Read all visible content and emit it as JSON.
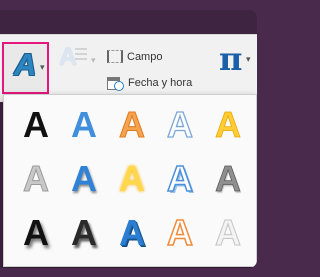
{
  "ribbon": {
    "wordart_button": {
      "icon": "wordart-a-icon",
      "glyph": "A",
      "color": "#2e86c1"
    },
    "ghost_button": {
      "glyph": "A"
    },
    "field_label": "Campo",
    "date_time_label": "Fecha y hora",
    "equation_glyph": "π"
  },
  "gallery": {
    "rows": [
      [
        {
          "glyph": "A",
          "style": "black-fill"
        },
        {
          "glyph": "A",
          "style": "blue-fill"
        },
        {
          "glyph": "A",
          "style": "orange-gradient-outline"
        },
        {
          "glyph": "A",
          "style": "blue-outline"
        },
        {
          "glyph": "A",
          "style": "gold-fill"
        }
      ],
      [
        {
          "glyph": "A",
          "style": "gray-outline"
        },
        {
          "glyph": "A",
          "style": "blue-shadow"
        },
        {
          "glyph": "A",
          "style": "yellow-glow"
        },
        {
          "glyph": "A",
          "style": "blue-outline-3d"
        },
        {
          "glyph": "A",
          "style": "gray-bevel"
        }
      ],
      [
        {
          "glyph": "A",
          "style": "black-shadow"
        },
        {
          "glyph": "A",
          "style": "dark-shadow"
        },
        {
          "glyph": "A",
          "style": "blue-3d"
        },
        {
          "glyph": "A",
          "style": "orange-outline"
        },
        {
          "glyph": "A",
          "style": "light-gray"
        }
      ]
    ]
  },
  "colors": {
    "highlight_border": "#e3177d",
    "window_background": "#4a2a4c",
    "ribbon_background": "#f1f1f1"
  }
}
